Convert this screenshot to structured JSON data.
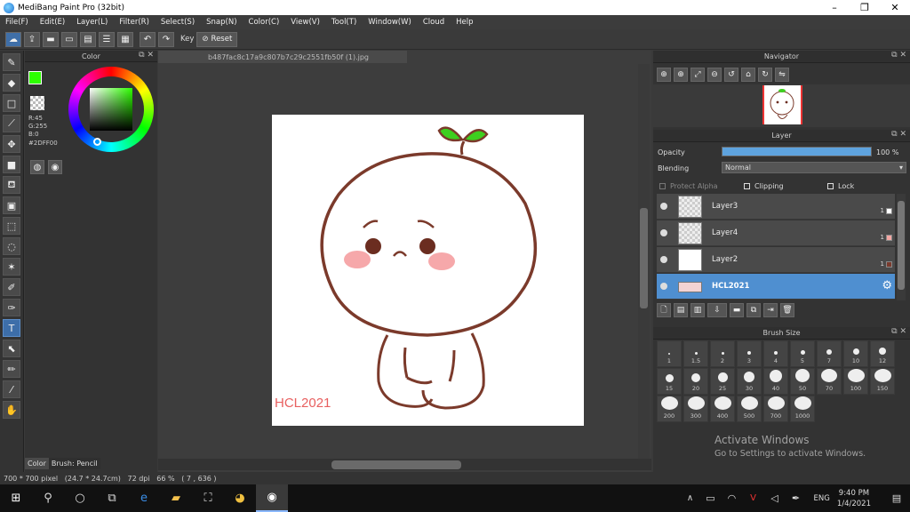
{
  "window": {
    "title": "MediBang Paint Pro (32bit)",
    "minimize": "–",
    "maximize": "❐",
    "close": "✕"
  },
  "menu": [
    "File(F)",
    "Edit(E)",
    "Layer(L)",
    "Filter(R)",
    "Select(S)",
    "Snap(N)",
    "Color(C)",
    "View(V)",
    "Tool(T)",
    "Window(W)",
    "Cloud",
    "Help"
  ],
  "toolbar": {
    "key_label": "Key",
    "reset_label": "Reset"
  },
  "color_panel": {
    "title": "Color",
    "fg_color": "#2DFF00",
    "r_label": "R:45",
    "g_label": "G:255",
    "b_label": "B:0",
    "hex_label": "#2DFF00"
  },
  "tool_tabs": {
    "color_tab": "Color",
    "brush_tab": "Brush: Pencil"
  },
  "document": {
    "tab_title": "b487fac8c17a9c807b7c29c2551fb50f (1).jpg",
    "signature": "HCL2021"
  },
  "navigator": {
    "title": "Navigator"
  },
  "layer_panel": {
    "title": "Layer",
    "opacity_label": "Opacity",
    "opacity_value": "100 %",
    "opacity_fraction": 1.0,
    "blending_label": "Blending",
    "blending_value": "Normal",
    "protect_alpha": "Protect Alpha",
    "clipping": "Clipping",
    "lock": "Lock",
    "layers": [
      {
        "name": "Layer3",
        "num": "1",
        "swatch": "#ffffff"
      },
      {
        "name": "Layer4",
        "num": "1",
        "swatch": "#f4a7a3"
      },
      {
        "name": "Layer2",
        "num": "1",
        "swatch": "#7a3b2e"
      },
      {
        "name": "HCL2021",
        "num": "",
        "swatch": ""
      }
    ]
  },
  "brush_size": {
    "title": "Brush Size",
    "sizes": [
      "1",
      "1.5",
      "2",
      "3",
      "4",
      "5",
      "7",
      "10",
      "12",
      "15",
      "20",
      "25",
      "30",
      "40",
      "50",
      "70",
      "100",
      "150",
      "200",
      "300",
      "400",
      "500",
      "700",
      "1000"
    ]
  },
  "status": {
    "text": "700 * 700 pixel   (24.7 * 24.7cm)   72 dpi   66 %   ( 7 , 636 )"
  },
  "watermark": {
    "line1": "Activate Windows",
    "line2": "Go to Settings to activate Windows."
  },
  "taskbar": {
    "lang": "ENG",
    "time": "9:40 PM",
    "date": "1/4/2021"
  }
}
